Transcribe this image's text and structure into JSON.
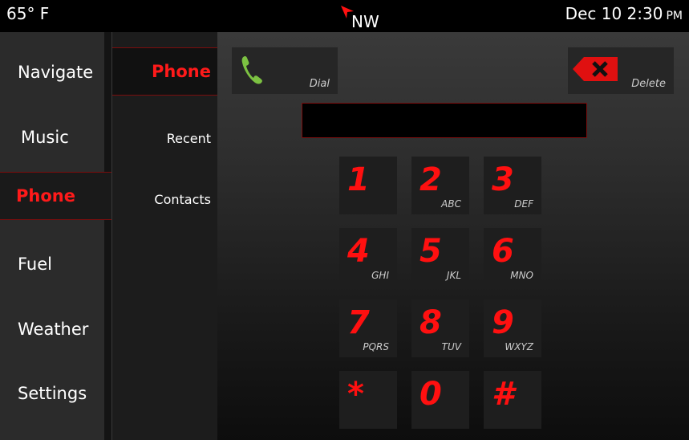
{
  "status": {
    "temperature": "65° F",
    "compass_heading": "NW",
    "date": "Dec 10",
    "time": "2:30",
    "ampm": "PM"
  },
  "main_menu": {
    "items": [
      {
        "label": "Navigate",
        "active": false
      },
      {
        "label": "Music",
        "active": false
      },
      {
        "label": "Phone",
        "active": true
      },
      {
        "label": "Fuel",
        "active": false
      },
      {
        "label": "Weather",
        "active": false
      },
      {
        "label": "Settings",
        "active": false
      }
    ]
  },
  "sub_menu": {
    "items": [
      {
        "label": "Phone",
        "active": true
      },
      {
        "label": "Recent",
        "active": false
      },
      {
        "label": "Contacts",
        "active": false
      }
    ]
  },
  "actions": {
    "dial_label": "Dial",
    "delete_label": "Delete"
  },
  "number_display": {
    "value": ""
  },
  "keypad": [
    {
      "digit": "1",
      "letters": ""
    },
    {
      "digit": "2",
      "letters": "ABC"
    },
    {
      "digit": "3",
      "letters": "DEF"
    },
    {
      "digit": "4",
      "letters": "GHI"
    },
    {
      "digit": "5",
      "letters": "JKL"
    },
    {
      "digit": "6",
      "letters": "MNO"
    },
    {
      "digit": "7",
      "letters": "PQRS"
    },
    {
      "digit": "8",
      "letters": "TUV"
    },
    {
      "digit": "9",
      "letters": "WXYZ"
    },
    {
      "digit": "*",
      "letters": ""
    },
    {
      "digit": "0",
      "letters": ""
    },
    {
      "digit": "#",
      "letters": ""
    }
  ],
  "colors": {
    "accent": "#ff1010",
    "dial_green": "#7cc142",
    "delete_red": "#e01010"
  }
}
